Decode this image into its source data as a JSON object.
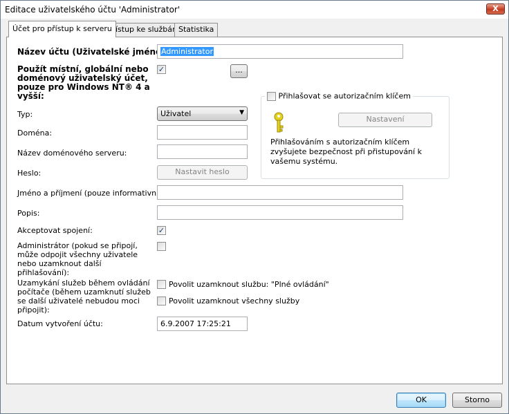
{
  "window": {
    "title": "Editace uživatelského účtu 'Administrator'",
    "close_label": "X"
  },
  "tabs": [
    {
      "label": "Účet pro přístup k serveru",
      "active": true
    },
    {
      "label": "Přístup ke službám",
      "active": false
    },
    {
      "label": "Statistika",
      "active": false
    }
  ],
  "form": {
    "account_name_label": "Název účtu (Uživatelské jméno):",
    "account_name_value": "Administrator",
    "use_account_label": "Použít místní, globální nebo doménový uživatelský účet, pouze pro Windows NT® 4 a vyšší:",
    "use_account_checked": true,
    "browse_button": "...",
    "type_label": "Typ:",
    "type_value": "Uživatel",
    "domain_label": "Doména:",
    "domain_value": "",
    "domain_server_label": "Název doménového serveru:",
    "domain_server_value": "",
    "password_label": "Heslo:",
    "set_password_button": "Nastavit heslo",
    "full_name_label": "Jméno a příjmení (pouze informativní):",
    "full_name_value": "",
    "description_label": "Popis:",
    "description_value": "",
    "accept_label": "Akceptovat spojení:",
    "accept_checked": true,
    "admin_label": "Administrátor (pokud se připojí, může odpojit všechny uživatele nebo uzamknout další přihlašování):",
    "admin_checked": false,
    "lock_label": "Uzamykání služeb během ovládání počítače (během uzamknutí služeb se další uživatelé nebudou moci připojit):",
    "lock_option1": "Povolit uzamknout službu: \"Plné ovládání\"",
    "lock_option1_checked": false,
    "lock_option2": "Povolit uzamknout všechny služby",
    "lock_option2_checked": false,
    "created_label": "Datum vytvoření účtu:",
    "created_value": "6.9.2007 17:25:21"
  },
  "key_group": {
    "title": "Přihlašovat se autorizačním klíčem",
    "checked": false,
    "settings_button": "Nastavení",
    "description": "Přihlašováním s autorizačním klíčem zvyšujete bezpečnost při přistupování k vašemu systému.",
    "icon": "key-icon",
    "icon_color": "#e5d21e"
  },
  "footer": {
    "ok": "OK",
    "cancel": "Storno"
  },
  "glyphs": {
    "check": "✓",
    "dropdown": "▼"
  }
}
